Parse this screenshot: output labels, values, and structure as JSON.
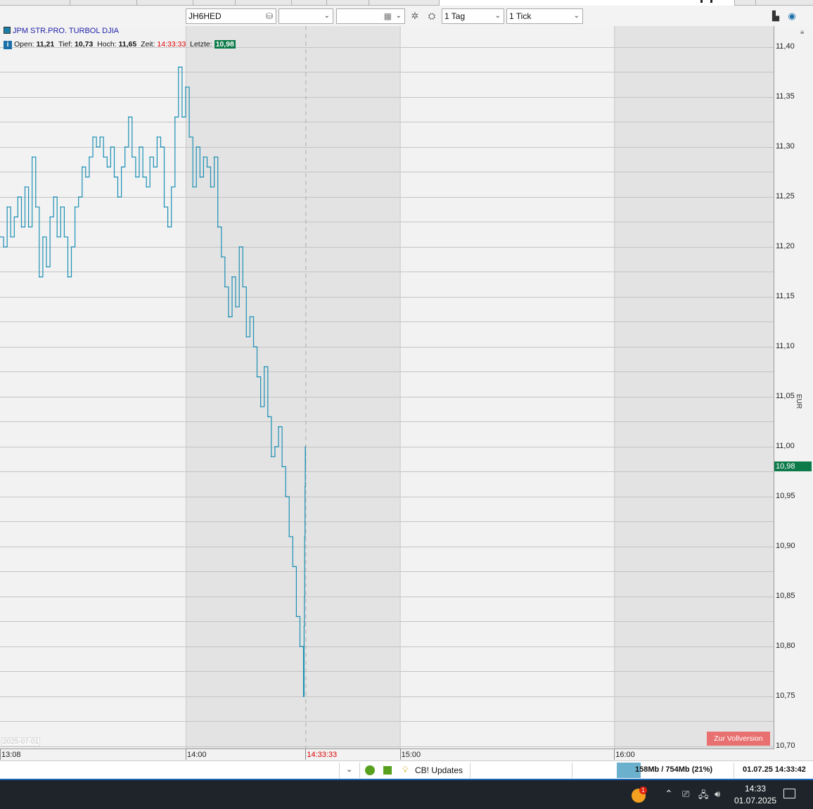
{
  "toolbar": {
    "symbol": "JH6HED",
    "period": "1 Tag",
    "interval": "1 Tick",
    "empty_field_1": "",
    "empty_field_2": ""
  },
  "legend": {
    "instrument": "JPM STR.PRO. TURBOL DJIA",
    "open_label": "Open:",
    "open_value": "11,21",
    "low_label": "Tief:",
    "low_value": "10,73",
    "high_label": "Hoch:",
    "high_value": "11,65",
    "time_label": "Zeit:",
    "time_value": "14:33:33",
    "last_label": "Letzte:",
    "last_value": "10,98"
  },
  "axis": {
    "currency": "EUR",
    "current_price_label": "10,98",
    "date_stamp": "2025-07-01",
    "y_ticks": [
      "11,40",
      "11,35",
      "11,30",
      "11,25",
      "11,20",
      "11,15",
      "11,10",
      "11,05",
      "11,00",
      "10,95",
      "10,90",
      "10,85",
      "10,80",
      "10,75",
      "10,70"
    ],
    "x_ticks": [
      "13:08",
      "14:00",
      "14:33:33",
      "15:00",
      "16:00"
    ]
  },
  "full_version_button": "Zur Vollversion",
  "statusbar": {
    "updates": "CB! Updates",
    "memory": "158Mb / 754Mb (21%)",
    "datetime": "01.07.25  14:33:42"
  },
  "taskbar": {
    "time": "14:33",
    "date": "01.07.2025",
    "badge": "1"
  },
  "colors": {
    "line": "#1a8fb5",
    "price_tag": "#0d7a4a",
    "button": "#e87070"
  },
  "chart_data": {
    "type": "line",
    "title": "JPM STR.PRO. TURBOL DJIA",
    "ylabel": "EUR",
    "ylim": [
      10.7,
      11.42
    ],
    "x_unit": "time (hh:mm)",
    "x_range": [
      "13:08",
      "16:40"
    ],
    "series": [
      {
        "name": "JPM STR.PRO. TURBOL DJIA",
        "points": [
          [
            "13:08",
            11.21
          ],
          [
            "13:09",
            11.2
          ],
          [
            "13:10",
            11.24
          ],
          [
            "13:11",
            11.21
          ],
          [
            "13:12",
            11.23
          ],
          [
            "13:13",
            11.25
          ],
          [
            "13:14",
            11.22
          ],
          [
            "13:15",
            11.26
          ],
          [
            "13:16",
            11.22
          ],
          [
            "13:17",
            11.29
          ],
          [
            "13:18",
            11.24
          ],
          [
            "13:19",
            11.17
          ],
          [
            "13:20",
            11.21
          ],
          [
            "13:21",
            11.18
          ],
          [
            "13:22",
            11.23
          ],
          [
            "13:23",
            11.25
          ],
          [
            "13:24",
            11.21
          ],
          [
            "13:25",
            11.24
          ],
          [
            "13:26",
            11.21
          ],
          [
            "13:27",
            11.17
          ],
          [
            "13:28",
            11.2
          ],
          [
            "13:29",
            11.24
          ],
          [
            "13:30",
            11.25
          ],
          [
            "13:31",
            11.28
          ],
          [
            "13:32",
            11.27
          ],
          [
            "13:33",
            11.29
          ],
          [
            "13:34",
            11.31
          ],
          [
            "13:35",
            11.3
          ],
          [
            "13:36",
            11.31
          ],
          [
            "13:37",
            11.29
          ],
          [
            "13:38",
            11.28
          ],
          [
            "13:39",
            11.3
          ],
          [
            "13:40",
            11.27
          ],
          [
            "13:41",
            11.25
          ],
          [
            "13:42",
            11.28
          ],
          [
            "13:43",
            11.3
          ],
          [
            "13:44",
            11.33
          ],
          [
            "13:45",
            11.29
          ],
          [
            "13:46",
            11.27
          ],
          [
            "13:47",
            11.3
          ],
          [
            "13:48",
            11.27
          ],
          [
            "13:49",
            11.26
          ],
          [
            "13:50",
            11.29
          ],
          [
            "13:51",
            11.28
          ],
          [
            "13:52",
            11.31
          ],
          [
            "13:53",
            11.3
          ],
          [
            "13:54",
            11.24
          ],
          [
            "13:55",
            11.22
          ],
          [
            "13:56",
            11.26
          ],
          [
            "13:57",
            11.33
          ],
          [
            "13:58",
            11.38
          ],
          [
            "13:59",
            11.33
          ],
          [
            "14:00",
            11.36
          ],
          [
            "14:01",
            11.31
          ],
          [
            "14:02",
            11.26
          ],
          [
            "14:03",
            11.3
          ],
          [
            "14:04",
            11.27
          ],
          [
            "14:05",
            11.29
          ],
          [
            "14:06",
            11.28
          ],
          [
            "14:07",
            11.26
          ],
          [
            "14:08",
            11.29
          ],
          [
            "14:09",
            11.22
          ],
          [
            "14:10",
            11.19
          ],
          [
            "14:11",
            11.16
          ],
          [
            "14:12",
            11.13
          ],
          [
            "14:13",
            11.17
          ],
          [
            "14:14",
            11.14
          ],
          [
            "14:15",
            11.2
          ],
          [
            "14:16",
            11.16
          ],
          [
            "14:17",
            11.11
          ],
          [
            "14:18",
            11.13
          ],
          [
            "14:19",
            11.1
          ],
          [
            "14:20",
            11.07
          ],
          [
            "14:21",
            11.04
          ],
          [
            "14:22",
            11.08
          ],
          [
            "14:23",
            11.03
          ],
          [
            "14:24",
            10.99
          ],
          [
            "14:25",
            11.0
          ],
          [
            "14:26",
            11.02
          ],
          [
            "14:27",
            10.98
          ],
          [
            "14:28",
            10.95
          ],
          [
            "14:29",
            10.91
          ],
          [
            "14:30",
            10.88
          ],
          [
            "14:31",
            10.83
          ],
          [
            "14:32",
            10.8
          ],
          [
            "14:33",
            10.75
          ],
          [
            "14:33:10",
            10.82
          ],
          [
            "14:33:15",
            10.85
          ],
          [
            "14:33:20",
            10.91
          ],
          [
            "14:33:25",
            10.96
          ],
          [
            "14:33:30",
            11.0
          ],
          [
            "14:33:33",
            10.98
          ]
        ]
      }
    ],
    "grid": true,
    "legend": "top-left"
  }
}
